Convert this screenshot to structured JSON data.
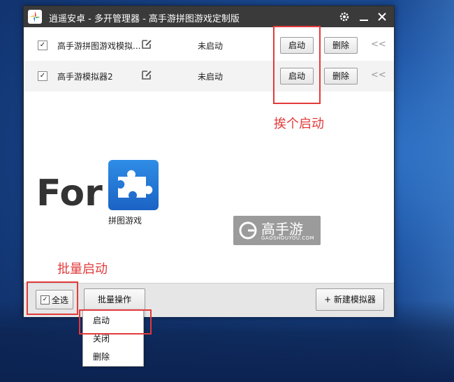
{
  "window": {
    "title": "逍遥安卓 - 多开管理器 - 高手游拼图游戏定制版"
  },
  "emulators": [
    {
      "checked": "✓",
      "name": "高手游拼图游戏模拟...",
      "status": "未启动",
      "start_label": "启动",
      "delete_label": "删除",
      "more": "<<"
    },
    {
      "checked": "✓",
      "name": "高手游模拟器2",
      "status": "未启动",
      "start_label": "启动",
      "delete_label": "删除",
      "more": "<<"
    }
  ],
  "annotations": {
    "one_by_one": "挨个启动",
    "batch_start": "批量启动"
  },
  "promo": {
    "for_text": "For",
    "game_name": "拼图游戏",
    "watermark_text": "高手游",
    "watermark_sub": "GAOSHOUYOU.COM"
  },
  "footer": {
    "select_all_check": "✓",
    "select_all_label": "全选",
    "batch_label": "批量操作",
    "new_label": "+ 新建模拟器"
  },
  "batch_menu": {
    "items": [
      "启动",
      "关闭",
      "删除"
    ]
  },
  "colors": {
    "titlebar": "#3a3a3a",
    "annotation_red": "#e23a3a",
    "footer_bg": "#e6e6e6"
  }
}
